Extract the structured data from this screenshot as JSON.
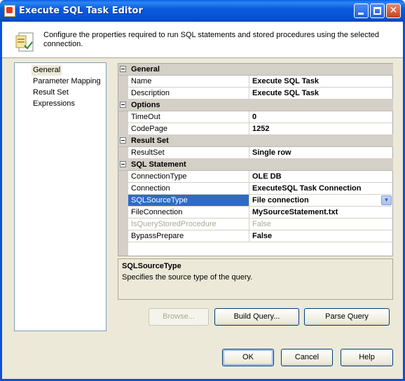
{
  "window": {
    "title": "Execute SQL Task Editor"
  },
  "header": {
    "description": "Configure the properties required to run SQL statements and stored procedures using the selected connection."
  },
  "nav": {
    "items": [
      "General",
      "Parameter Mapping",
      "Result Set",
      "Expressions"
    ],
    "selected": "General"
  },
  "grid": {
    "categories": {
      "general": "General",
      "options": "Options",
      "result_set": "Result Set",
      "sql_statement": "SQL Statement"
    },
    "rows": {
      "name": {
        "label": "Name",
        "value": "Execute SQL Task"
      },
      "description": {
        "label": "Description",
        "value": "Execute SQL Task"
      },
      "timeout": {
        "label": "TimeOut",
        "value": "0"
      },
      "codepage": {
        "label": "CodePage",
        "value": "1252"
      },
      "resultset": {
        "label": "ResultSet",
        "value": "Single row"
      },
      "connection_type": {
        "label": "ConnectionType",
        "value": "OLE DB"
      },
      "connection": {
        "label": "Connection",
        "value": "ExecuteSQL Task Connection"
      },
      "sql_source_type": {
        "label": "SQLSourceType",
        "value": "File connection"
      },
      "file_connection": {
        "label": "FileConnection",
        "value": "MySourceStatement.txt"
      },
      "is_query_stored_procedure": {
        "label": "IsQueryStoredProcedure",
        "value": "False"
      },
      "bypass_prepare": {
        "label": "BypassPrepare",
        "value": "False"
      }
    }
  },
  "help_pane": {
    "title": "SQLSourceType",
    "text": "Specifies the source type of the query."
  },
  "actions": {
    "browse": "Browse...",
    "build_query": "Build Query...",
    "parse_query": "Parse Query"
  },
  "dialog_buttons": {
    "ok": "OK",
    "cancel": "Cancel",
    "help": "Help"
  },
  "colors": {
    "title_bar": "#0a5cdd",
    "selection": "#316ac5",
    "dialog_bg": "#ece9d8"
  }
}
